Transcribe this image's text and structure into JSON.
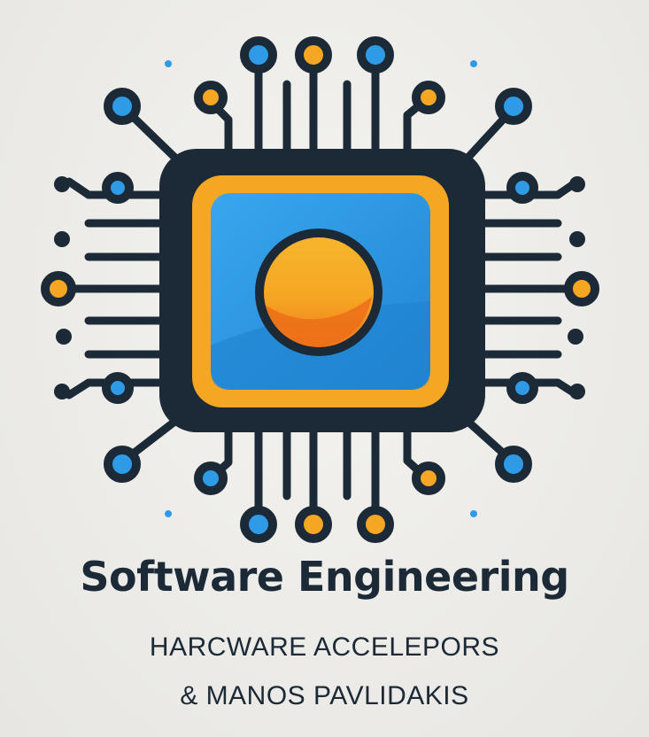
{
  "logo": {
    "title": "Software Engineering",
    "subtitle": "HARCWARE ACCELEPORS",
    "author": "& MANOS PAVLIDAKIS"
  },
  "colors": {
    "dark": "#1c2936",
    "blue": "#2f9be6",
    "orange": "#f5a623",
    "deep_orange": "#f07b1d",
    "background": "#eeede9"
  },
  "icons": {
    "emblem": "chip-icon"
  }
}
